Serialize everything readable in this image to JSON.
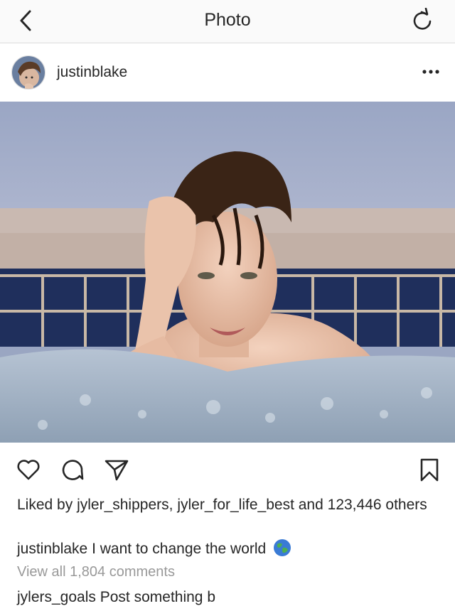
{
  "nav": {
    "title": "Photo",
    "back_icon": "chevron-left-icon",
    "refresh_icon": "refresh-icon"
  },
  "post": {
    "username": "justinblake",
    "more_icon": "more-dots-icon",
    "avatar_icon": "avatar"
  },
  "actions": {
    "like_icon": "heart-icon",
    "comment_icon": "comment-icon",
    "share_icon": "send-icon",
    "save_icon": "bookmark-icon"
  },
  "likes": {
    "prefix": "Liked by",
    "user1": "jyler_shippers",
    "separator": ",",
    "user2": "jyler_for_life_best",
    "and_text": "and",
    "count": "123,446",
    "suffix": "others"
  },
  "caption": {
    "username": "justinblake",
    "text": "I want to change the world",
    "emoji_icon": "globe-icon"
  },
  "view_all_comments": "View all 1,804 comments",
  "comment": {
    "username": "jylers_goals",
    "text": "Post something b"
  },
  "colors": {
    "text": "#262626",
    "muted": "#999999",
    "border": "#dbdbdb",
    "nav_bg": "#fafafa"
  }
}
